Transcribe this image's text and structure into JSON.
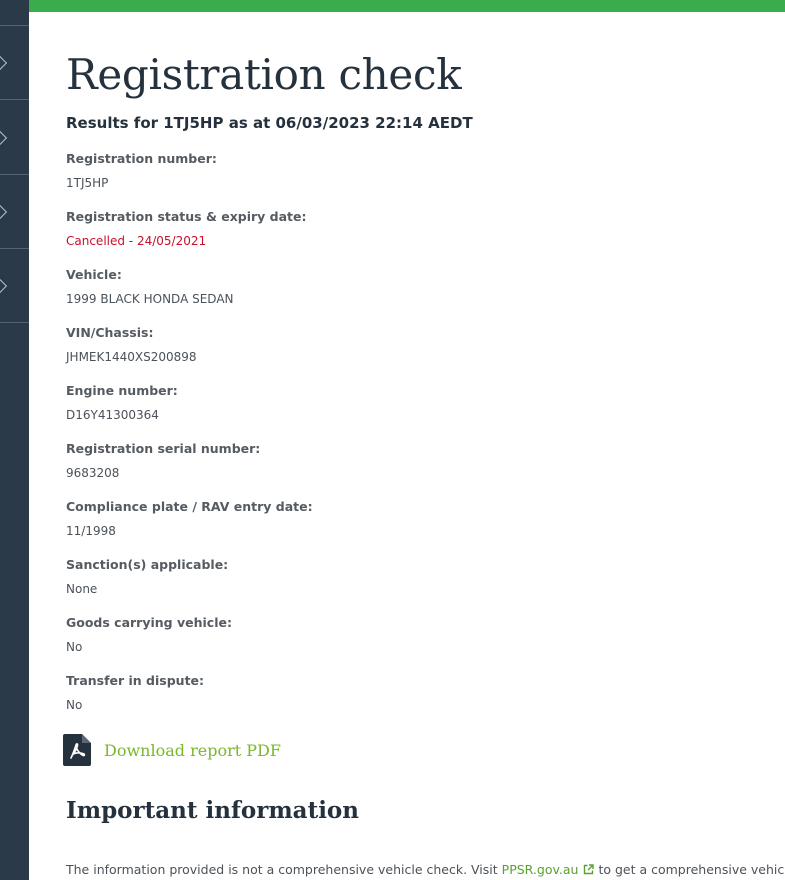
{
  "page": {
    "title": "Registration check",
    "results_line": "Results for 1TJ5HP as at 06/03/2023 22:14 AEDT"
  },
  "fields": [
    {
      "label": "Registration number:",
      "value": "1TJ5HP"
    },
    {
      "label": "Registration status & expiry date:",
      "value": "Cancelled - 24/05/2021"
    },
    {
      "label": "Vehicle:",
      "value": "1999 BLACK HONDA SEDAN"
    },
    {
      "label": "VIN/Chassis:",
      "value": "JHMEK1440XS200898"
    },
    {
      "label": "Engine number:",
      "value": "D16Y41300364"
    },
    {
      "label": "Registration serial number:",
      "value": "9683208"
    },
    {
      "label": "Compliance plate / RAV entry date:",
      "value": "11/1998"
    },
    {
      "label": "Sanction(s) applicable:",
      "value": "None"
    },
    {
      "label": "Goods carrying vehicle:",
      "value": "No"
    },
    {
      "label": "Transfer in dispute:",
      "value": "No"
    }
  ],
  "download": {
    "label": "Download report PDF",
    "icon": "pdf-file-icon"
  },
  "important": {
    "title": "Important information",
    "text_before": "The information provided is not a comprehensive vehicle check. Visit",
    "link_text": "PPSR.gov.au",
    "text_after": "to get a comprehensive vehicle"
  },
  "colors": {
    "accent_green": "#3aac4c",
    "link_green": "#78b829",
    "status_cancelled": "#c8102e",
    "sidebar": "#2b3a48"
  }
}
